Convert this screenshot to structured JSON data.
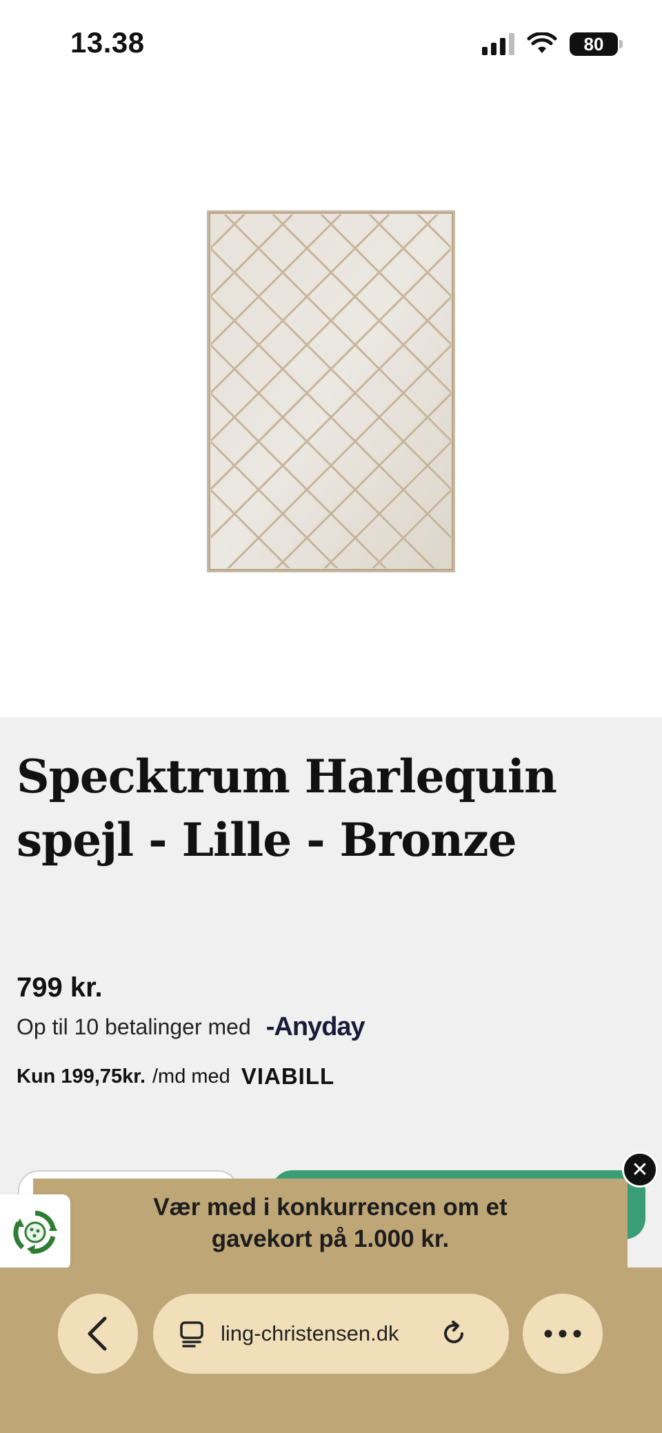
{
  "status_bar": {
    "time": "13.38",
    "battery": "80"
  },
  "product": {
    "title": "Specktrum Harlequin spejl - Lille - Bronze",
    "price": "799 kr.",
    "anyday_text": "Op til 10 betalinger med",
    "anyday_logo": "-Anyday",
    "viabill_amount": "Kun 199,75kr.",
    "viabill_suffix": "/md med",
    "viabill_logo": "VIABILL"
  },
  "promo": {
    "text": "Vær med i konkurrencen om et gavekort på 1.000 kr.",
    "close_symbol": "✕"
  },
  "browser": {
    "url": "ling-christensen.dk"
  },
  "colors": {
    "accent_green": "#3a9d76",
    "banner_tan": "#bea677",
    "pill_cream": "#f1dfba",
    "page_gray": "#f0f0f0"
  },
  "icons": [
    "signal-icon",
    "wifi-icon",
    "battery-icon",
    "close-icon",
    "recycle-icon",
    "back-arrow-icon",
    "tabs-icon",
    "reload-icon",
    "more-icon"
  ]
}
